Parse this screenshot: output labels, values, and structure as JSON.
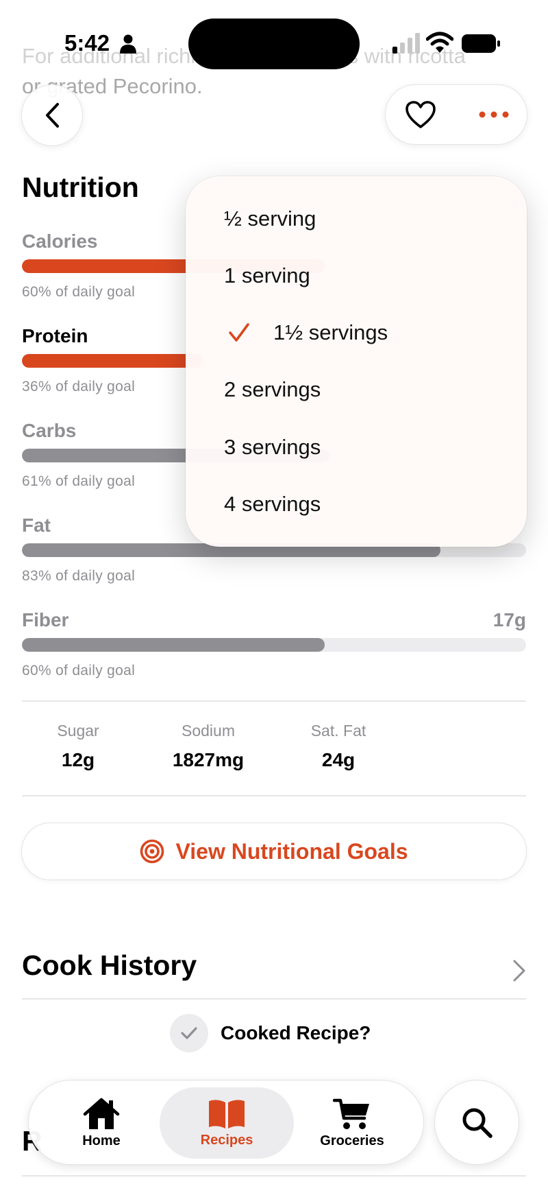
{
  "background_text": {
    "line1": "For additional richness, top portions with ricotta",
    "line2": "or grated Pecorino."
  },
  "status_bar": {
    "time": "5:42"
  },
  "nutrition": {
    "title": "Nutrition",
    "rows": [
      {
        "label": "Calories",
        "amount": "",
        "percent": 60,
        "goal": "60% of daily goal"
      },
      {
        "label": "Protein",
        "amount": "",
        "percent": 36,
        "goal": "36% of daily goal"
      },
      {
        "label": "Carbs",
        "amount": "",
        "percent": 61,
        "goal": "61% of daily goal"
      },
      {
        "label": "Fat",
        "amount": "",
        "percent": 83,
        "goal": "83% of daily goal"
      },
      {
        "label": "Fiber",
        "amount": "17g",
        "percent": 60,
        "goal": "60% of daily goal"
      }
    ],
    "extras": [
      {
        "label": "Sugar",
        "value": "12g"
      },
      {
        "label": "Sodium",
        "value": "1827mg"
      },
      {
        "label": "Sat. Fat",
        "value": "24g"
      }
    ],
    "goals_button": "View Nutritional Goals"
  },
  "cook_history": {
    "title": "Cook History",
    "cooked_label": "Cooked Recipe?"
  },
  "next_section_title": "R",
  "servings_menu": {
    "items": [
      {
        "label": "½ serving",
        "checked": false
      },
      {
        "label": "1 serving",
        "checked": false
      },
      {
        "label": "1½ servings",
        "checked": true
      },
      {
        "label": "2 servings",
        "checked": false
      },
      {
        "label": "3 servings",
        "checked": false
      },
      {
        "label": "4 servings",
        "checked": false
      }
    ]
  },
  "tab_bar": {
    "home": "Home",
    "recipes": "Recipes",
    "groceries": "Groceries",
    "selected": "recipes"
  },
  "colors": {
    "accent": "#d9471f",
    "secondary_text": "#8e8e93",
    "track": "#ececee",
    "neutral_bar": "#8e8e93"
  }
}
